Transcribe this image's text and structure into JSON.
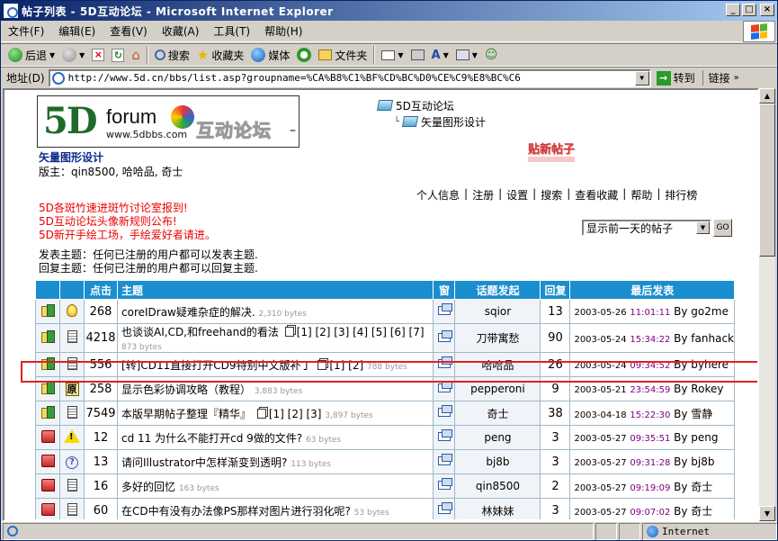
{
  "window": {
    "title": "帖子列表 - 5D互动论坛 - Microsoft Internet Explorer",
    "controls": [
      "_",
      "□",
      "×"
    ]
  },
  "menu": [
    "文件(F)",
    "编辑(E)",
    "查看(V)",
    "收藏(A)",
    "工具(T)",
    "帮助(H)"
  ],
  "toolbar": {
    "back": "后退",
    "search": "搜索",
    "favorites": "收藏夹",
    "media": "媒体",
    "folders": "文件夹"
  },
  "address": {
    "label": "地址(D)",
    "url": "http://www.5d.cn/bbs/list.asp?groupname=%CA%B8%C1%BF%CD%BC%D0%CE%C9%E8%BC%C6",
    "go": "转到",
    "links": "链接"
  },
  "status": {
    "zone": "Internet"
  },
  "colors": {
    "header_blue": "#1a8ecf",
    "notice_red": "#e00000",
    "highlight_red": "#e02020",
    "time_purple": "#800080"
  },
  "logo": {
    "mark": "5D",
    "word": "forum",
    "domain": "www.5dbbs.com",
    "cn": "互动论坛"
  },
  "board": {
    "title": "矢量图形设计",
    "moderators": "版主：qin8500, 哈哈品, 奇士"
  },
  "breadcrumb": {
    "root": "5D互动论坛",
    "child": "矢量图形设计"
  },
  "new_post": "贴新帖子",
  "usernav": [
    "个人信息",
    "注册",
    "设置",
    "搜索",
    "查看收藏",
    "帮助",
    "排行榜"
  ],
  "notices": [
    "5D各斑竹速进斑竹讨论室报到!",
    "5D互动论坛头像新规则公布!",
    "5D新开手绘工场，手绘爱好者请进。"
  ],
  "filter": {
    "selected": "显示前一天的帖子",
    "go": "GO"
  },
  "permissions": {
    "post": "发表主题：任何已注册的用户都可以发表主题.",
    "reply": "回复主题：任何已注册的用户都可以回复主题."
  },
  "table": {
    "headers": {
      "hits": "点击",
      "subject": "主题",
      "window": "窗",
      "author": "话题发起",
      "replies": "回复",
      "last": "最后发表"
    },
    "rows": [
      {
        "state": "hot",
        "type": "bulb",
        "hits": "268",
        "subject": "coreIDraw疑难杂症的解决.",
        "pages": "",
        "bytes": "2,310 bytes",
        "author": "sqior",
        "replies": "13",
        "date": "2003-05-26",
        "time": "11:01:11",
        "by": "By go2me"
      },
      {
        "state": "hot",
        "type": "doc",
        "hits": "4218",
        "subject": "也谈谈AI,CD,和freehand的看法",
        "pages": "[1] [2] [3] [4] [5] [6] [7]",
        "bytes": "873 bytes",
        "author": "刀带寓愁",
        "replies": "90",
        "date": "2003-05-24",
        "time": "15:34:22",
        "by": "By fanhack"
      },
      {
        "state": "hot",
        "type": "doc",
        "hits": "556",
        "subject": "[转]CD11直接打开CD9特别中文版补丁",
        "pages": "[1] [2]",
        "bytes": "788 bytes",
        "author": "哈哈品",
        "replies": "26",
        "date": "2003-05-24",
        "time": "09:34:52",
        "by": "By byhere"
      },
      {
        "state": "hot",
        "type": "yuan",
        "hits": "258",
        "subject": "显示色彩协调攻略（教程）",
        "pages": "",
        "bytes": "3,883 bytes",
        "author": "pepperoni",
        "replies": "9",
        "date": "2003-05-21",
        "time": "23:54:59",
        "by": "By Rokey"
      },
      {
        "state": "hot",
        "type": "doc",
        "hits": "7549",
        "subject": "本版早期帖子整理『精华』",
        "pages": "[1] [2] [3]",
        "bytes": "3,897 bytes",
        "author": "奇士",
        "replies": "38",
        "date": "2003-04-18",
        "time": "15:22:30",
        "by": "By 雪静"
      },
      {
        "state": "normal",
        "type": "warn",
        "hits": "12",
        "subject": "cd 11 为什么不能打开cd 9做的文件?",
        "pages": "",
        "bytes": "63 bytes",
        "author": "peng",
        "replies": "3",
        "date": "2003-05-27",
        "time": "09:35:51",
        "by": "By peng"
      },
      {
        "state": "normal",
        "type": "question",
        "hits": "13",
        "subject": "请问Illustrator中怎样渐变到透明?",
        "pages": "",
        "bytes": "113 bytes",
        "author": "bj8b",
        "replies": "3",
        "date": "2003-05-27",
        "time": "09:31:28",
        "by": "By bj8b"
      },
      {
        "state": "normal",
        "type": "doc",
        "hits": "16",
        "subject": "多好的回忆",
        "pages": "",
        "bytes": "163 bytes",
        "author": "qin8500",
        "replies": "2",
        "date": "2003-05-27",
        "time": "09:19:09",
        "by": "By 奇士"
      },
      {
        "state": "normal",
        "type": "doc",
        "hits": "60",
        "subject": "在CD中有没有办法像PS那样对图片进行羽化呢?",
        "pages": "",
        "bytes": "53 bytes",
        "author": "林妹妹",
        "replies": "3",
        "date": "2003-05-27",
        "time": "09:07:02",
        "by": "By 奇士"
      }
    ]
  }
}
